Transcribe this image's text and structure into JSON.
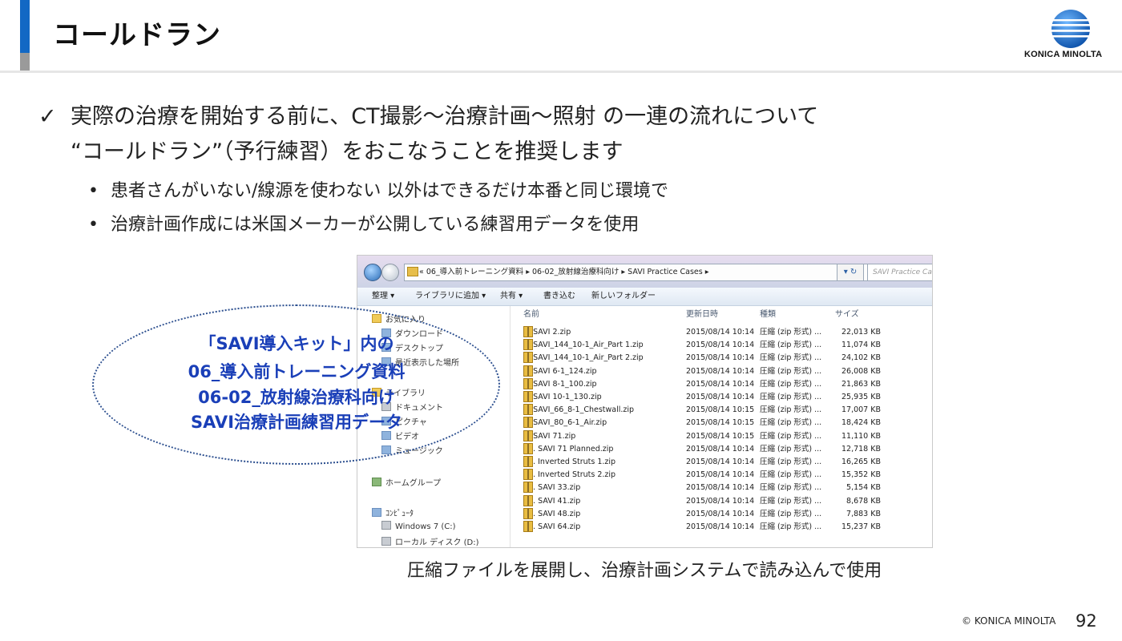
{
  "header": {
    "title": "コールドラン",
    "logo_text": "KONICA MINOLTA"
  },
  "body": {
    "check_mark": "✓",
    "check_line1": "実際の治療を開始する前に、CT撮影〜治療計画〜照射 の一連の流れについて",
    "check_line2": "“コールドラン”（予行練習）をおこなうことを推奨します",
    "bullets": [
      "患者さんがいない/線源を使わない 以外はできるだけ本番と同じ環境で",
      "治療計画作成には米国メーカーが公開している練習用データを使用"
    ],
    "bullet_glyph": "•"
  },
  "explorer": {
    "breadcrumb": "« 06_導入前トレーニング資料 ▸ 06-02_放射線治療科向け ▸ SAVI Practice Cases ▸",
    "refresh": "▾ ↻",
    "search_placeholder": "SAVI Practice Ca",
    "toolbar": [
      "整理 ▾",
      "ライブラリに追加 ▾",
      "共有 ▾",
      "書き込む",
      "新しいフォルダー"
    ],
    "sidebar": [
      "お気に入り",
      "ダウンロード",
      "デスクトップ",
      "最近表示した場所",
      "ライブラリ",
      "ドキュメント",
      "ピクチャ",
      "ビデオ",
      "ミュージック",
      "ホームグループ",
      "ｺﾝﾋﾟｭｰﾀ",
      "Windows 7 (C:)",
      "ローカル ディスク (D:)"
    ],
    "columns": [
      "名前",
      "更新日時",
      "種類",
      "サイズ"
    ],
    "files": [
      {
        "name": "1. SAVI 2.zip",
        "date": "2015/08/14 10:14",
        "type": "圧縮 (zip 形式) ...",
        "size": "22,013 KB"
      },
      {
        "name": "2. SAVI_144_10-1_Air_Part 1.zip",
        "date": "2015/08/14 10:14",
        "type": "圧縮 (zip 形式) ...",
        "size": "11,074 KB"
      },
      {
        "name": "3. SAVI_144_10-1_Air_Part 2.zip",
        "date": "2015/08/14 10:14",
        "type": "圧縮 (zip 形式) ...",
        "size": "24,102 KB"
      },
      {
        "name": "4. SAVI 6-1_124.zip",
        "date": "2015/08/14 10:14",
        "type": "圧縮 (zip 形式) ...",
        "size": "26,008 KB"
      },
      {
        "name": "5. SAVI 8-1_100.zip",
        "date": "2015/08/14 10:14",
        "type": "圧縮 (zip 形式) ...",
        "size": "21,863 KB"
      },
      {
        "name": "6. SAVI 10-1_130.zip",
        "date": "2015/08/14 10:14",
        "type": "圧縮 (zip 形式) ...",
        "size": "25,935 KB"
      },
      {
        "name": "7. SAVI_66_8-1_Chestwall.zip",
        "date": "2015/08/14 10:15",
        "type": "圧縮 (zip 形式) ...",
        "size": "17,007 KB"
      },
      {
        "name": "8. SAVI_80_6-1_Air.zip",
        "date": "2015/08/14 10:15",
        "type": "圧縮 (zip 形式) ...",
        "size": "18,424 KB"
      },
      {
        "name": "9. SAVI 71.zip",
        "date": "2015/08/14 10:15",
        "type": "圧縮 (zip 形式) ...",
        "size": "11,110 KB"
      },
      {
        "name": "10. SAVI 71 Planned.zip",
        "date": "2015/08/14 10:14",
        "type": "圧縮 (zip 形式) ...",
        "size": "12,718 KB"
      },
      {
        "name": "11. Inverted Struts 1.zip",
        "date": "2015/08/14 10:14",
        "type": "圧縮 (zip 形式) ...",
        "size": "16,265 KB"
      },
      {
        "name": "12. Inverted Struts 2.zip",
        "date": "2015/08/14 10:14",
        "type": "圧縮 (zip 形式) ...",
        "size": "15,352 KB"
      },
      {
        "name": "13. SAVI 33.zip",
        "date": "2015/08/14 10:14",
        "type": "圧縮 (zip 形式) ...",
        "size": "5,154 KB"
      },
      {
        "name": "14. SAVI 41.zip",
        "date": "2015/08/14 10:14",
        "type": "圧縮 (zip 形式) ...",
        "size": "8,678 KB"
      },
      {
        "name": "15. SAVI 48.zip",
        "date": "2015/08/14 10:14",
        "type": "圧縮 (zip 形式) ...",
        "size": "7,883 KB"
      },
      {
        "name": "16. SAVI 64.zip",
        "date": "2015/08/14 10:14",
        "type": "圧縮 (zip 形式) ...",
        "size": "15,237 KB"
      }
    ]
  },
  "callout": {
    "lines": [
      "「SAVI導入キット」内の",
      "06_導入前トレーニング資料",
      "06-02_放射線治療科向け",
      "SAVI治療計画練習用データ"
    ]
  },
  "caption": "圧縮ファイルを展開し、治療計画システムで読み込んで使用",
  "footer": {
    "copyright": "© KONICA MINOLTA",
    "page": "92"
  },
  "colors": {
    "accent_blue": "#1268c4",
    "callout_text": "#1a3fb8"
  }
}
